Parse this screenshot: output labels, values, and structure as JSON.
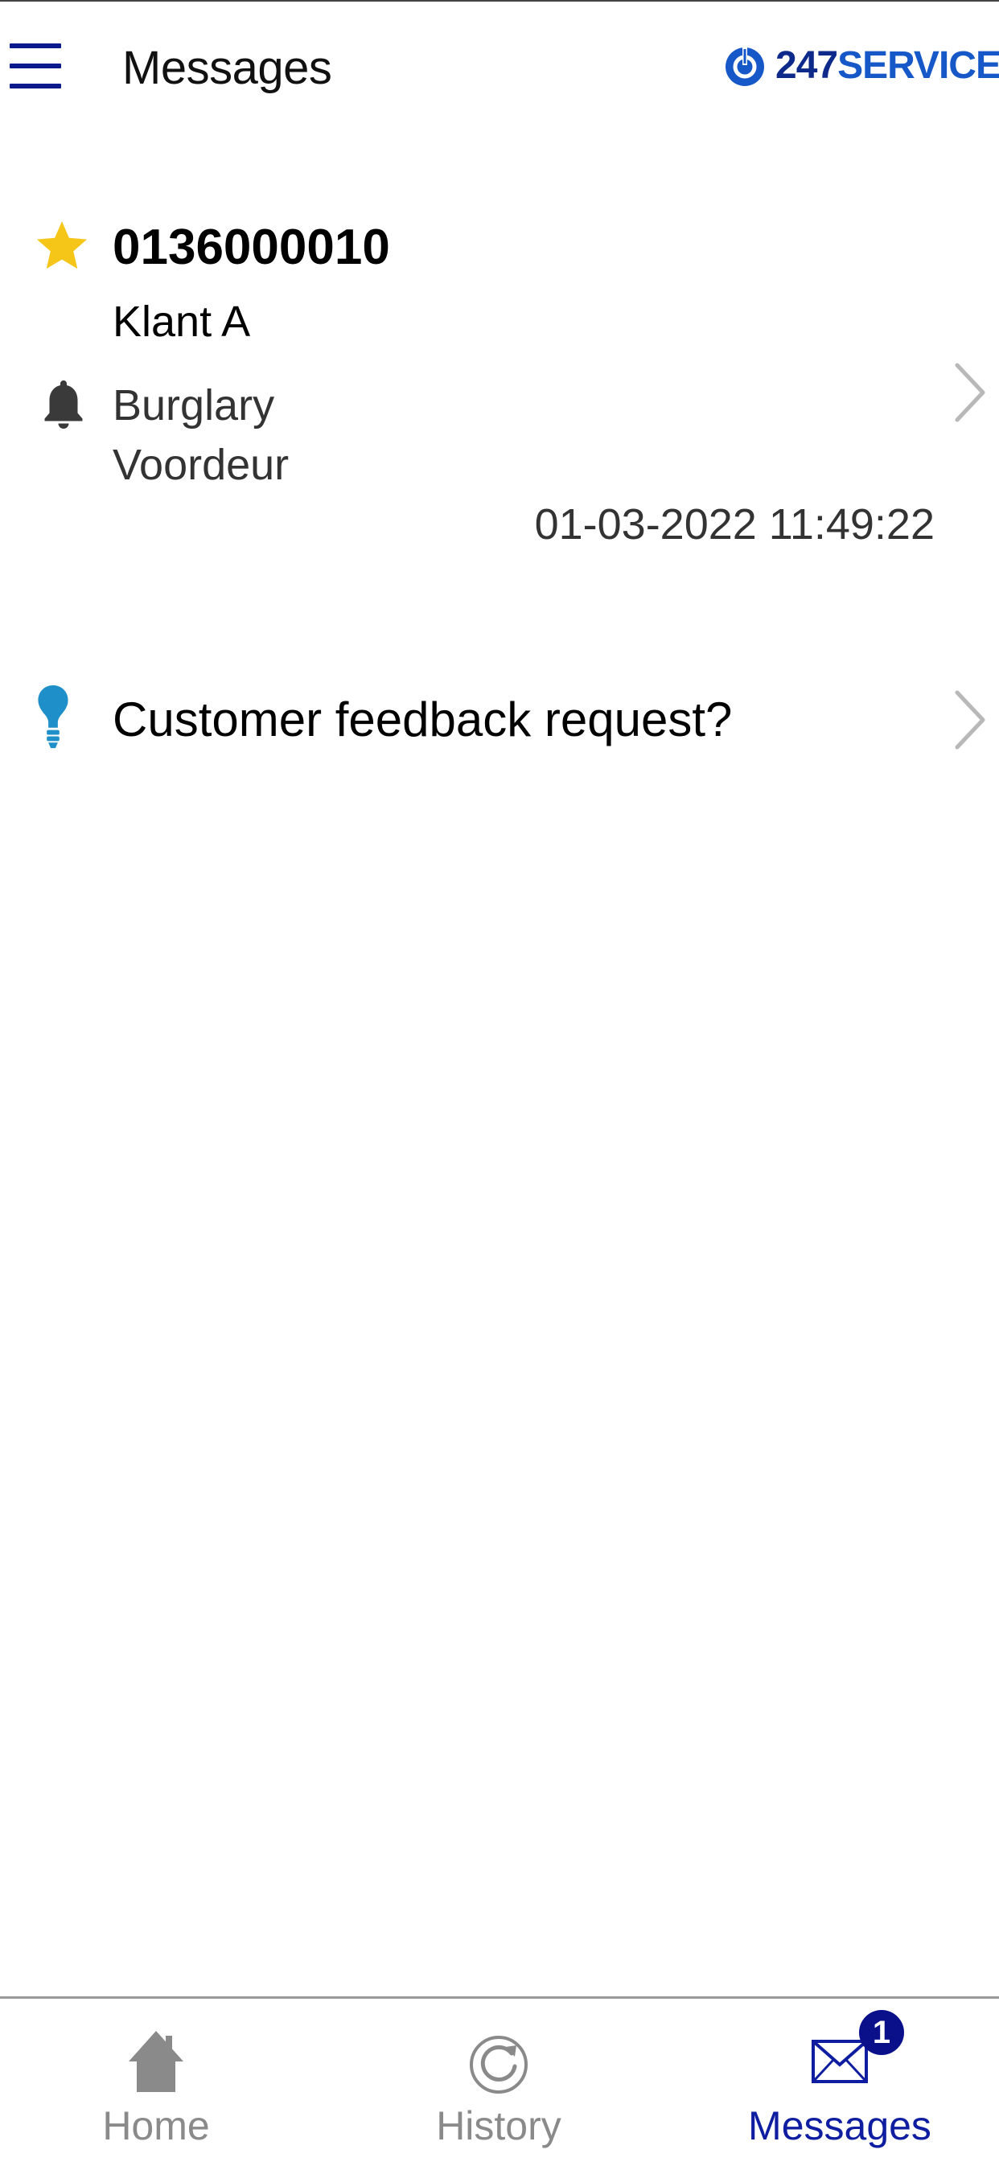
{
  "header": {
    "title": "Messages",
    "brand_number": "247",
    "brand_name": "SERVICES",
    "menu_icon": "hamburger-menu-icon"
  },
  "message": {
    "starred": true,
    "alarm_number": "0136000010",
    "customer": "Klant A",
    "alarm_type": "Burglary",
    "zone": "Voordeur",
    "timestamp": "01-03-2022 11:49:22",
    "icons": [
      "star-icon",
      "bell-icon",
      "chevron-right-icon"
    ]
  },
  "feedback": {
    "label": "Customer feedback request?",
    "icon": "lightbulb-icon"
  },
  "tabbar": {
    "tabs": [
      {
        "label": "Home",
        "icon": "home-icon",
        "active": false
      },
      {
        "label": "History",
        "icon": "history-icon",
        "active": false
      },
      {
        "label": "Messages",
        "icon": "envelope-icon",
        "active": true,
        "badge": "1"
      }
    ]
  },
  "colors": {
    "accent": "#0f1da0",
    "star": "#f5c518",
    "bulb": "#1f8fc9",
    "inactive_tab": "#8a8a8a",
    "brand_blue": "#1758c9"
  }
}
